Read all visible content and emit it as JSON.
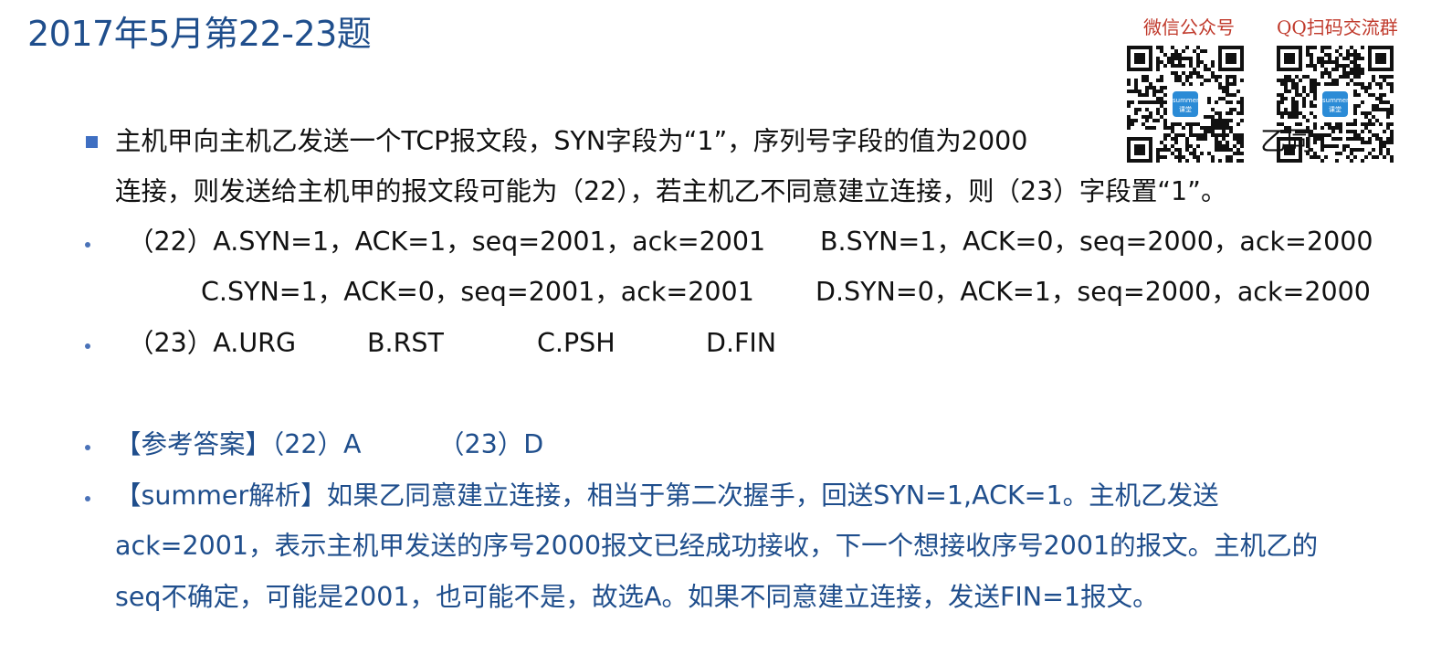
{
  "title": "2017年5月第22-23题",
  "qr": {
    "wechat_caption": "微信公众号",
    "qq_caption": "QQ扫码交流群",
    "logo_text_top": "summer",
    "logo_text_bottom": "课堂"
  },
  "question": {
    "line1": "主机甲向主机乙发送一个TCP报文段，SYN字段为“1”，序列号字段的值为2000",
    "line1_tail": "乙同",
    "line2": "连接，则发送给主机甲的报文段可能为（22），若主机乙不同意建立连接，则（23）字段置“1”。"
  },
  "options22": {
    "a": "（22）A.SYN=1，ACK=1，seq=2001，ack=2001",
    "b": "B.SYN=1，ACK=0，seq=2000，ack=2000",
    "c": "C.SYN=1，ACK=0，seq=2001，ack=2001",
    "d": "D.SYN=0，ACK=1，seq=2000，ack=2000"
  },
  "options23": {
    "a": "（23）A.URG",
    "b": "B.RST",
    "c": "C.PSH",
    "d": "D.FIN"
  },
  "answer": {
    "label": "【参考答案】（22）A",
    "part2": "（23）D"
  },
  "analysis": {
    "line1": "【summer解析】如果乙同意建立连接，相当于第二次握手，回送SYN=1,ACK=1。主机乙发送",
    "line2": "ack=2001，表示主机甲发送的序号2000报文已经成功接收，下一个想接收序号2001的报文。主机乙的",
    "line3": "seq不确定，可能是2001，也可能不是，故选A。如果不同意建立连接，发送FIN=1报文。"
  }
}
